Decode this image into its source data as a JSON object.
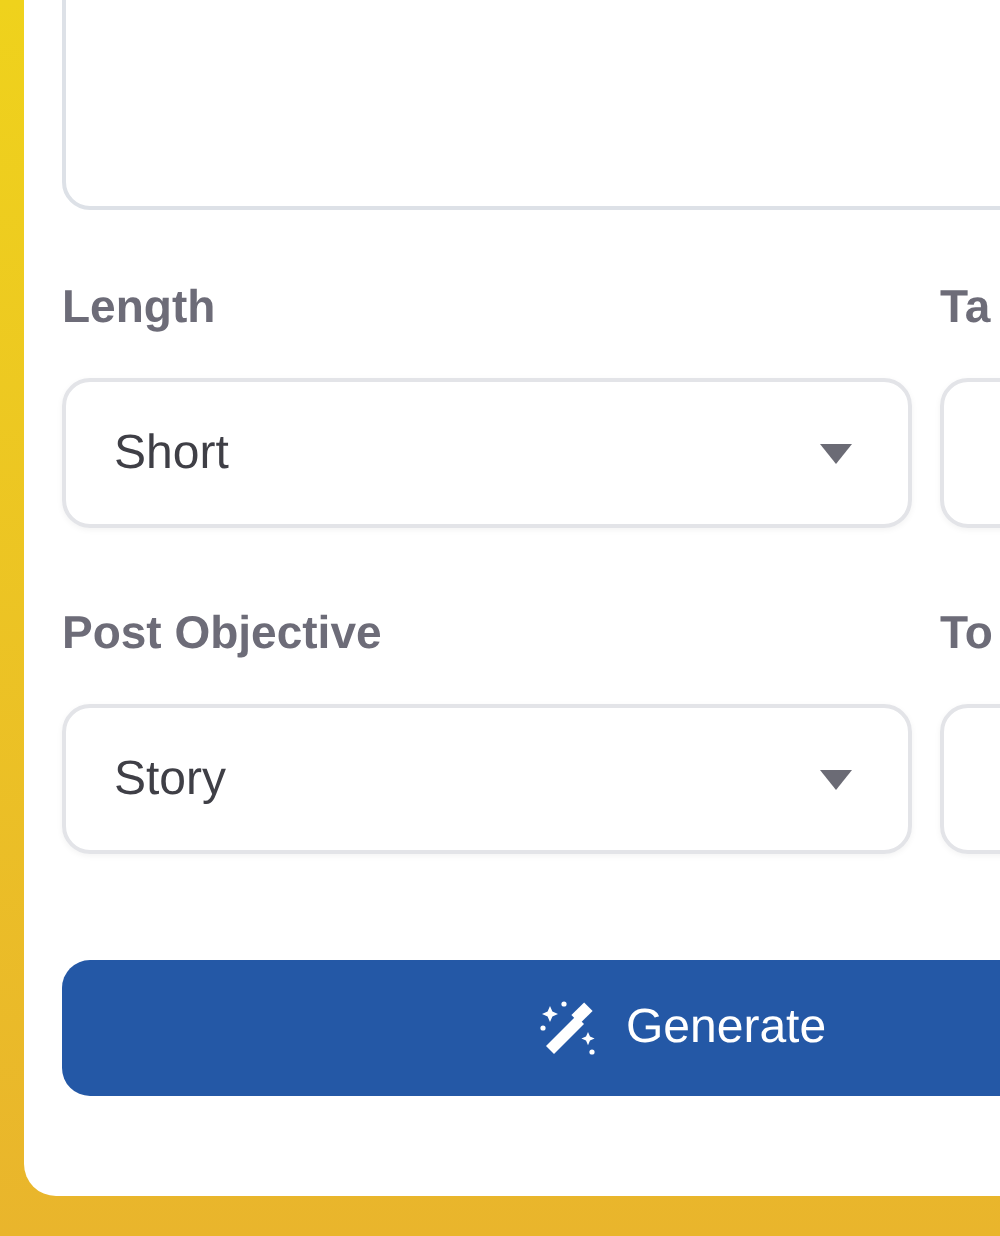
{
  "description_box": {
    "kind": "textarea"
  },
  "fields": [
    {
      "label": "Length",
      "value": "Short"
    },
    {
      "label": "Ta"
    },
    {
      "label": "Post Objective",
      "value": "Story"
    },
    {
      "label": "To"
    }
  ],
  "generate_button": {
    "label": "Generate"
  }
}
